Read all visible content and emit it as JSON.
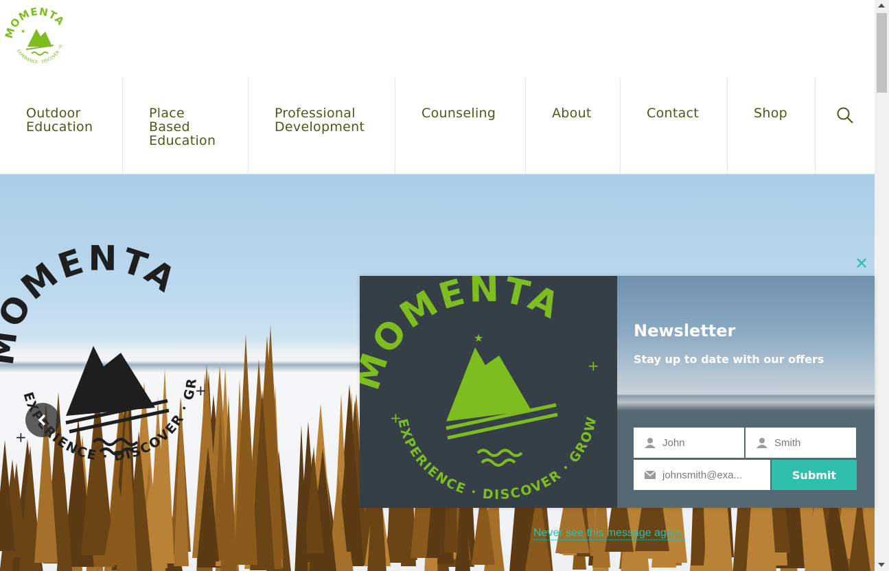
{
  "site": {
    "logo_name": "MOMENTA",
    "logo_tagline": "EXPERIENCE · DISCOVER · GROW"
  },
  "nav": {
    "items": [
      {
        "label": "Outdoor\nEducation"
      },
      {
        "label": "Place\nBased\nEducation"
      },
      {
        "label": "Professional\nDevelopment"
      },
      {
        "label": "Counseling"
      },
      {
        "label": "About"
      },
      {
        "label": "Contact"
      },
      {
        "label": "Shop"
      }
    ],
    "search_icon": "search-icon"
  },
  "hero": {
    "prev_icon": "chevron-left-icon"
  },
  "popup": {
    "close_label": "✕",
    "title": "Newsletter",
    "subtitle": "Stay up to date with our offers",
    "first_name_placeholder": "John",
    "last_name_placeholder": "Smith",
    "email_placeholder": "johnsmith@exa...",
    "submit_label": "Submit",
    "dismiss_link": "Never see this message again."
  },
  "colors": {
    "brand_green": "#7dbd1f",
    "nav_text": "#4a5a16",
    "accent_teal": "#2fbfaa",
    "popup_dark": "#353f48"
  }
}
